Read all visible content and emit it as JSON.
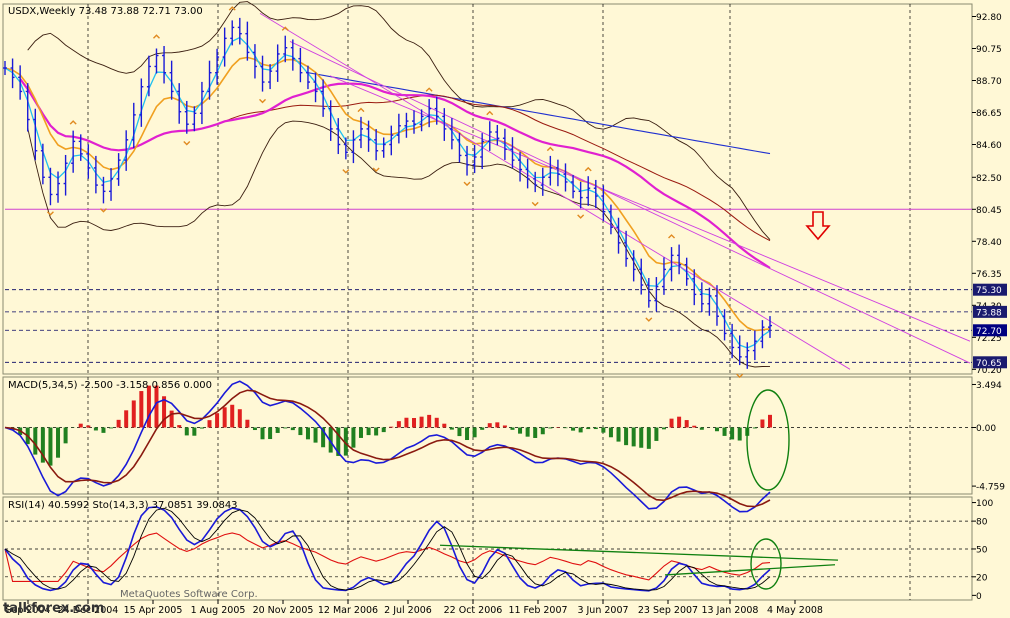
{
  "chart_data": [
    {
      "type": "line",
      "title": "USDX,Weekly  73.48 73.88 72.71 73.00",
      "price_axis_ticks": [
        92.8,
        90.75,
        88.7,
        86.65,
        84.6,
        82.5,
        80.45,
        78.4,
        76.35,
        74.3,
        72.25,
        70.2
      ],
      "price_markers": [
        75.3,
        73.88,
        72.7,
        70.65
      ],
      "horizontal_level": 80.45,
      "ylim": [
        69.9,
        93.6
      ],
      "x_tick_labels": [
        "Sep 2004",
        "24 Dec 2004",
        "15 Apr 2005",
        "1 Aug 2005",
        "20 Nov 2005",
        "12 Mar 2006",
        "2 Jul 2006",
        "22 Oct 2006",
        "11 Feb 2007",
        "3 Jun 2007",
        "23 Sep 2007",
        "13 Jan 2008",
        "4 May 2008"
      ],
      "series": [
        {
          "values": [
            89.5,
            88.9,
            88.0,
            86.2,
            84.2,
            82.5,
            81.4,
            82.1,
            83.4,
            84.8,
            84.0,
            83.1,
            82.0,
            81.6,
            82.4,
            83.6,
            84.9,
            86.5,
            88.3,
            89.6,
            90.3,
            89.2,
            88.0,
            86.7,
            85.9,
            86.6,
            88.0,
            89.2,
            90.2,
            91.4,
            92.1,
            91.7,
            90.5,
            89.6,
            88.6,
            89.3,
            90.4,
            90.8,
            90.1,
            89.2,
            88.6,
            88.0,
            86.9,
            85.6,
            84.6,
            84.1,
            84.9,
            85.6,
            84.9,
            84.2,
            84.6,
            85.2,
            85.8,
            86.1,
            85.9,
            86.4,
            86.9,
            86.4,
            85.6,
            84.9,
            83.9,
            83.3,
            83.8,
            84.8,
            85.4,
            85.0,
            84.3,
            83.6,
            83.0,
            82.4,
            82.0,
            82.5,
            83.1,
            82.7,
            82.2,
            81.6,
            81.2,
            81.8,
            81.3,
            80.3,
            79.3,
            78.3,
            77.3,
            76.6,
            75.6,
            74.6,
            75.5,
            76.6,
            77.5,
            76.9,
            76.0,
            75.0,
            74.4,
            74.9,
            73.6,
            72.5,
            71.6,
            71.0,
            71.4,
            72.0,
            72.9,
            73.0
          ]
        }
      ]
    },
    {
      "type": "bar",
      "title": "MACD(5,34,5)  -2.500  -3.158  0.856  0.000",
      "axis_ticks": [
        3.494,
        0.0,
        -4.759
      ],
      "ylim": [
        -5.4,
        4.1
      ]
    },
    {
      "type": "line",
      "title": "RSI(14) 40.5992   Sto(14,3,3) 37.0851 39.0843",
      "axis_ticks": [
        100,
        80,
        50,
        20,
        0
      ],
      "ylim": [
        -5,
        106
      ]
    }
  ],
  "watermark": {
    "brand": "talkforex.com",
    "copyright": "MetaQuotes Software Corp."
  }
}
